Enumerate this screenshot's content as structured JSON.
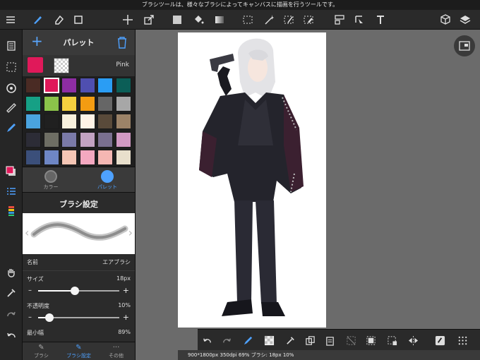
{
  "tooltip": "ブラシツールは、様々なブラシによってキャンバスに描画を行うツールです。",
  "palette": {
    "title": "パレット",
    "current_color": "#e0195a",
    "current_name": "Pink",
    "swatches": [
      "#4a2b24",
      "#e0195a",
      "#8e2da3",
      "#4f4fb0",
      "#2a9df4",
      "#0b5e57",
      "#16a085",
      "#8bc34a",
      "#f4d03f",
      "#f39c12",
      "#666666",
      "#a7a7a7",
      "#4aa3df",
      "#202020",
      "#f7f0dc",
      "#fff3e6",
      "#594a3a",
      "#9c8368",
      "#2c2c36",
      "#6e6e64",
      "#7a7aa8",
      "#c2a3c2",
      "#7a7090",
      "#d29ac4",
      "#3b4f7a",
      "#6e86c4",
      "#f5c6b5",
      "#f4a8c0",
      "#f5b7b3",
      "#e8dfcc"
    ]
  },
  "mode_tabs": {
    "color": "カラー",
    "palette": "パレット"
  },
  "brush": {
    "title": "ブラシ設定",
    "name_label": "名前",
    "name_value": "エアブラシ",
    "size_label": "サイズ",
    "size_value": "18px",
    "size_level": 0.45,
    "opacity_label": "不透明度",
    "opacity_value": "10%",
    "opacity_level": 0.14,
    "minwidth_label": "最小幅",
    "minwidth_value": "89%"
  },
  "bottom_tabs": {
    "brush": "ブラシ",
    "brush_settings": "ブラシ設定",
    "other": "その他"
  },
  "status": "900*1800px 350dpi 69% ブラシ: 18px 10%",
  "colors": {
    "accent": "#4ea1ff"
  }
}
